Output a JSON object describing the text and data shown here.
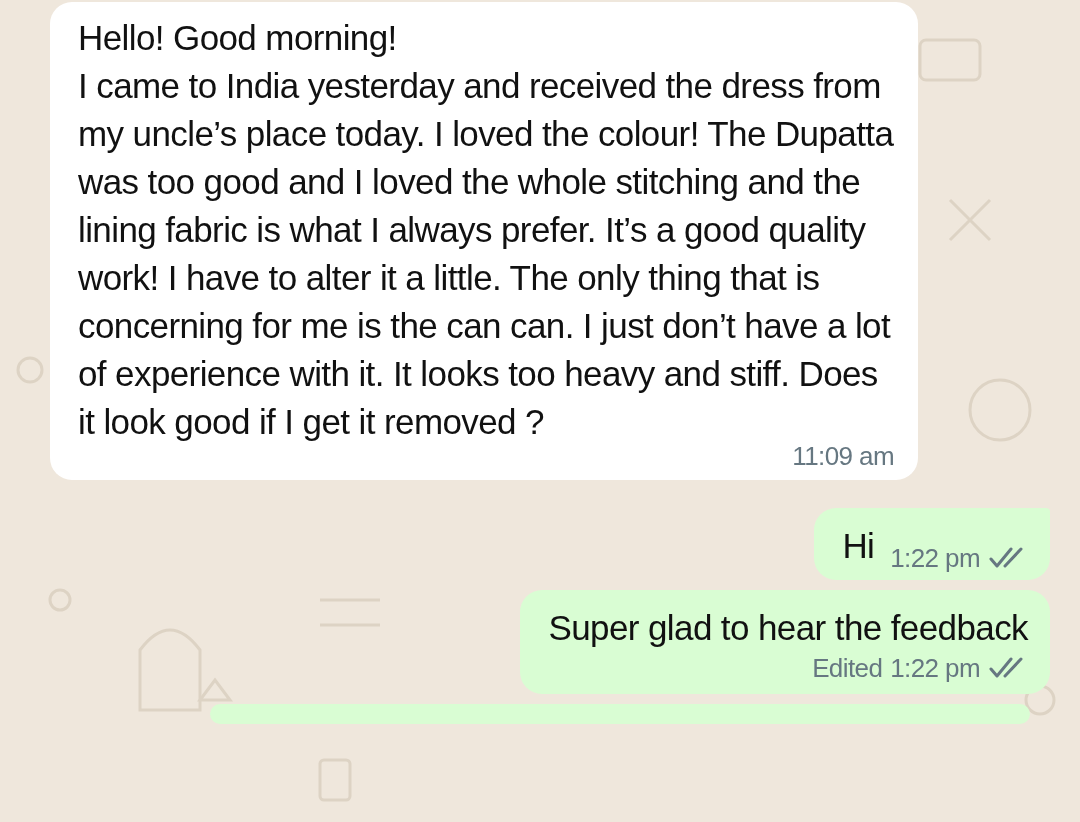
{
  "messages": [
    {
      "kind": "incoming",
      "paragraphs": [
        "Hello! Good morning!",
        "I came to India yesterday and received the dress from my uncle’s place today. I loved the colour! The Dupatta was too good and I loved the whole stitching and the lining fabric is what I always prefer. It’s a good quality work! I have to alter it a little. The only thing that is concerning for me is the can can. I just don’t have a lot of experience with it. It looks too heavy and stiff. Does it look good if I get it removed ?"
      ],
      "time": "11:09 am"
    },
    {
      "kind": "outgoing",
      "paragraphs": [
        "Hi"
      ],
      "time": "1:22 pm",
      "read": false
    },
    {
      "kind": "outgoing",
      "paragraphs": [
        "Super glad to hear the feedback"
      ],
      "edited_label": "Edited",
      "time": "1:22 pm",
      "read": false
    }
  ]
}
